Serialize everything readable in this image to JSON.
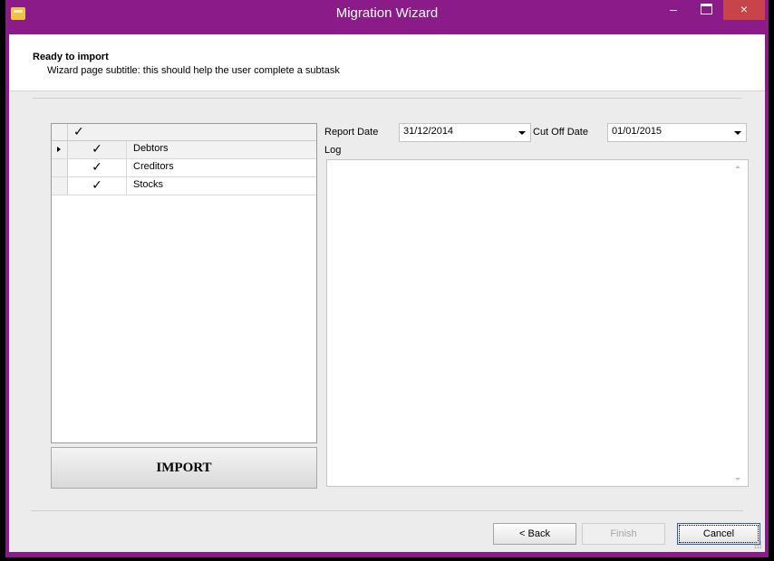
{
  "window": {
    "title": "Migration Wizard",
    "close_glyph": "×",
    "minimize_glyph": "–"
  },
  "header": {
    "title": "Ready to import",
    "subtitle": "Wizard page subtitle: this should help the user complete a subtask"
  },
  "grid": {
    "header_checked": true,
    "rows": [
      {
        "label": "Debtors",
        "checked": true,
        "selected": true
      },
      {
        "label": "Creditors",
        "checked": true,
        "selected": false
      },
      {
        "label": "Stocks",
        "checked": true,
        "selected": false
      }
    ],
    "check_glyph": "✓"
  },
  "import_button": "IMPORT",
  "report_date": {
    "label": "Report Date",
    "value": "31/12/2014"
  },
  "cut_off_date": {
    "label": "Cut Off Date",
    "value": "01/01/2015"
  },
  "log": {
    "label": "Log",
    "text": ""
  },
  "footer": {
    "back": "< Back",
    "finish": "Finish",
    "cancel": "Cancel"
  },
  "colors": {
    "titlebar": "#8b1b88",
    "close_button": "#c7444a"
  }
}
